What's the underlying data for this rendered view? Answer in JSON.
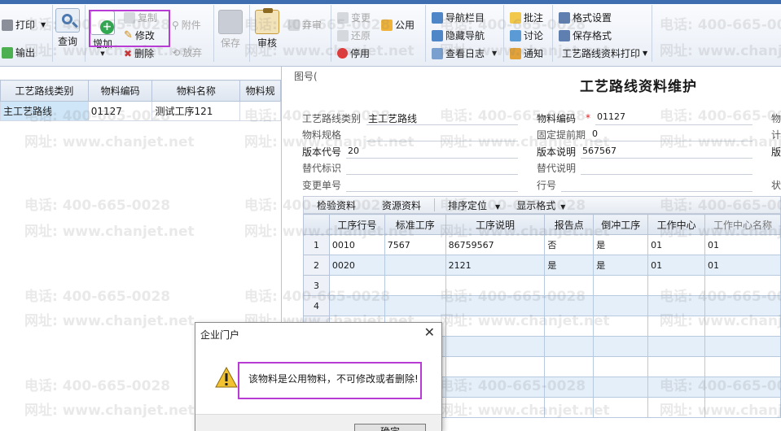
{
  "toolbar": {
    "print": "打印",
    "export": "输出",
    "query": "查询",
    "add": "增加",
    "copy": "复制",
    "modify": "修改",
    "delete": "删除",
    "attach": "附件",
    "discard": "放弃",
    "save": "保存",
    "audit": "审核",
    "abandon": "弃审",
    "change": "变更",
    "restore": "还原",
    "disable": "停用",
    "common": "公用",
    "nav_bar": "导航栏目",
    "hide_nav": "隐藏导航",
    "view_log": "查看日志",
    "annotate": "批注",
    "discuss": "讨论",
    "notify": "通知",
    "format_settings": "格式设置",
    "save_format": "保存格式",
    "route_print": "工艺路线资料打印"
  },
  "left_table": {
    "columns": [
      "工艺路线类别",
      "物料编码",
      "物料名称",
      "物料规"
    ],
    "rows": [
      [
        "主工艺路线",
        "01127",
        "测试工序121",
        ""
      ]
    ]
  },
  "form": {
    "title": "工艺路线资料维护",
    "partial_label": "图号(",
    "route_type_label": "工艺路线类别",
    "route_type_value": "主工艺路线",
    "material_code_label": "物料编码",
    "required_mark": "*",
    "material_code_value": "01127",
    "material_spec_label": "物料规格",
    "fixed_lead_label": "固定提前期",
    "fixed_lead_value": "0",
    "version_code_label": "版本代号",
    "version_code_value": "20",
    "version_desc_label": "版本说明",
    "version_desc_value": "567567",
    "alt_flag_label": "替代标识",
    "alt_desc_label": "替代说明",
    "change_no_label": "变更单号",
    "line_no_label": "行号",
    "cut_material": "物",
    "cut_count": "计",
    "cut_version": "版",
    "cut_status": "状"
  },
  "sub_toolbar": {
    "inspect": "检验资料",
    "resource": "资源资料",
    "sort": "排序定位",
    "display_format": "显示格式"
  },
  "detail_grid": {
    "columns": [
      "",
      "工序行号",
      "标准工序",
      "工序说明",
      "报告点",
      "倒冲工序",
      "工作中心",
      "工作中心名称"
    ],
    "rows": [
      [
        "1",
        "0010",
        "7567",
        "86759567",
        "否",
        "是",
        "01",
        "01"
      ],
      [
        "2",
        "0020",
        "",
        "2121",
        "是",
        "是",
        "01",
        "01"
      ],
      [
        "3",
        "",
        "",
        "",
        "",
        "",
        "",
        ""
      ],
      [
        "4",
        "",
        "",
        "",
        "",
        "",
        "",
        ""
      ],
      [
        "",
        "",
        "",
        "",
        "",
        "",
        "",
        ""
      ],
      [
        "",
        "",
        "",
        "",
        "",
        "",
        "",
        ""
      ],
      [
        "",
        "",
        "",
        "",
        "",
        "",
        "",
        ""
      ],
      [
        "",
        "",
        "",
        "",
        "",
        "",
        "",
        ""
      ],
      [
        "",
        "",
        "",
        "",
        "",
        "",
        "",
        ""
      ]
    ]
  },
  "dialog": {
    "title": "企业门户",
    "close": "✕",
    "message": "该物料是公用物料，不可修改或者删除!",
    "ok": "确定"
  },
  "watermark": {
    "phone": "电话: 400-665-0028",
    "site": "网址: www.chanjet.net"
  },
  "colors": {
    "highlight": "#b93bd6",
    "selection": "#cfe6f8",
    "grid_alt": "#e4eff9",
    "accent": "#3e6eb0"
  }
}
